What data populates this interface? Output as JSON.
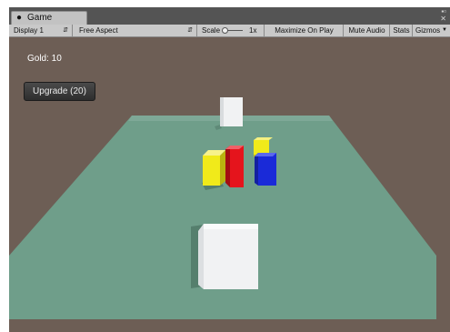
{
  "window": {
    "tab_title": "Game",
    "controls": [
      "▪▫",
      "✕"
    ]
  },
  "toolbar": {
    "display": "Display 1",
    "aspect": "Free Aspect",
    "scale_label": "Scale",
    "scale_value": "1x",
    "maximize_on_play": "Maximize On Play",
    "mute_audio": "Mute Audio",
    "stats": "Stats",
    "gizmos": "Gizmos"
  },
  "game": {
    "gold_text": "Gold: 10",
    "upgrade_button": "Upgrade (20)",
    "colors": {
      "background": "#6d5e55",
      "ground": "#6f9e8a",
      "white_cube": "#f1f2f3",
      "yellow_block": "#f0ea1a",
      "red_block": "#e5141c",
      "blue_block": "#1a2ad8"
    }
  }
}
